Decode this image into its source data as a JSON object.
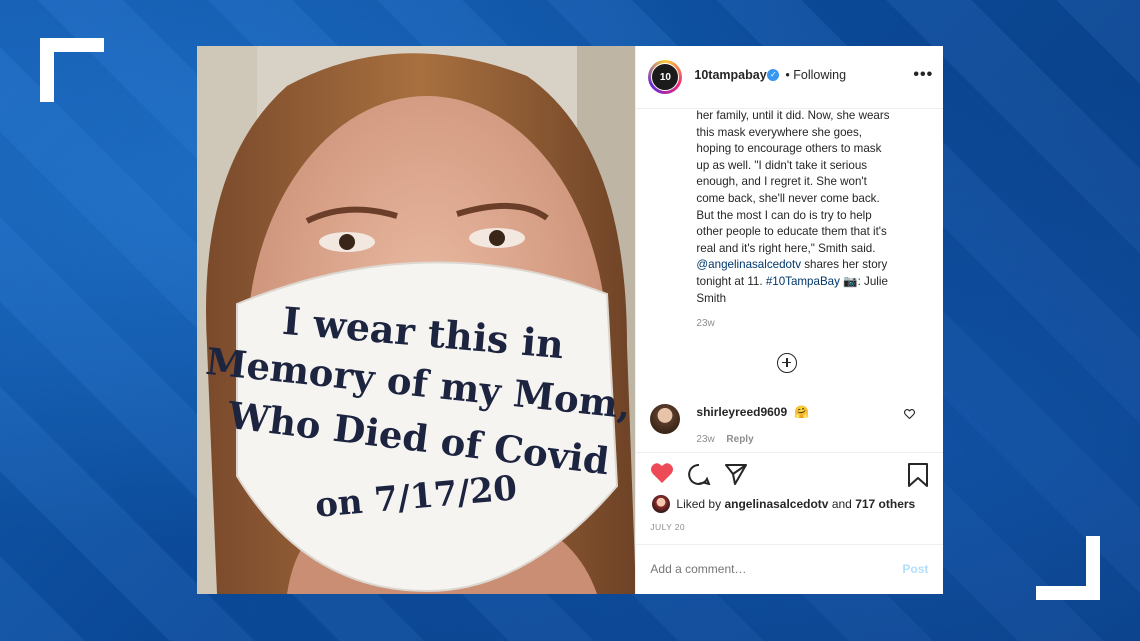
{
  "post": {
    "username": "10tampabay",
    "avatar_text": "10",
    "verified_icon": "verified-badge-icon",
    "following_label": "• Following",
    "more_icon": "more-options-icon",
    "image": {
      "description_icon": "photo-woman-in-mask",
      "mask_lines": [
        "I wear this in",
        "Memory of my Mom,",
        "Who Died of Covid",
        "on 7/17/20"
      ]
    },
    "caption": {
      "lines": [
        "her family, until it did. Now, she wears",
        "this mask everywhere she goes,",
        "hoping to encourage others to mask",
        "up as well. \"I didn't take it serious",
        "enough, and I regret it. She won't",
        "come back, she'll never come back.",
        "But the most I can do is try to help",
        "other people to educate them that it's",
        "real and it's right here,\" Smith said."
      ],
      "mention": "@angelinasalcedotv",
      "line10_rest": " shares her story",
      "line11_pre": "tonight at 11. ",
      "hashtag": "#10TampaBay",
      "camera_emoji": "📷",
      "line11_post": ": Julie",
      "line12": "Smith"
    },
    "caption_age": "23w",
    "load_more_icon": "plus-circle-icon",
    "comment": {
      "username": "shirleyreed9609",
      "emoji": "🤗",
      "age": "23w",
      "reply_label": "Reply"
    },
    "liked_prefix": "Liked by ",
    "liked_user": "angelinasalcedotv",
    "liked_mid": " and ",
    "liked_count": "717 others",
    "date": "JULY 20",
    "comment_placeholder": "Add a comment…",
    "post_button": "Post"
  },
  "colors": {
    "like_red": "#ed4956",
    "link_blue": "#00376b",
    "post_button": "#b2dffc",
    "frame_blue": "#0b4c9e"
  }
}
